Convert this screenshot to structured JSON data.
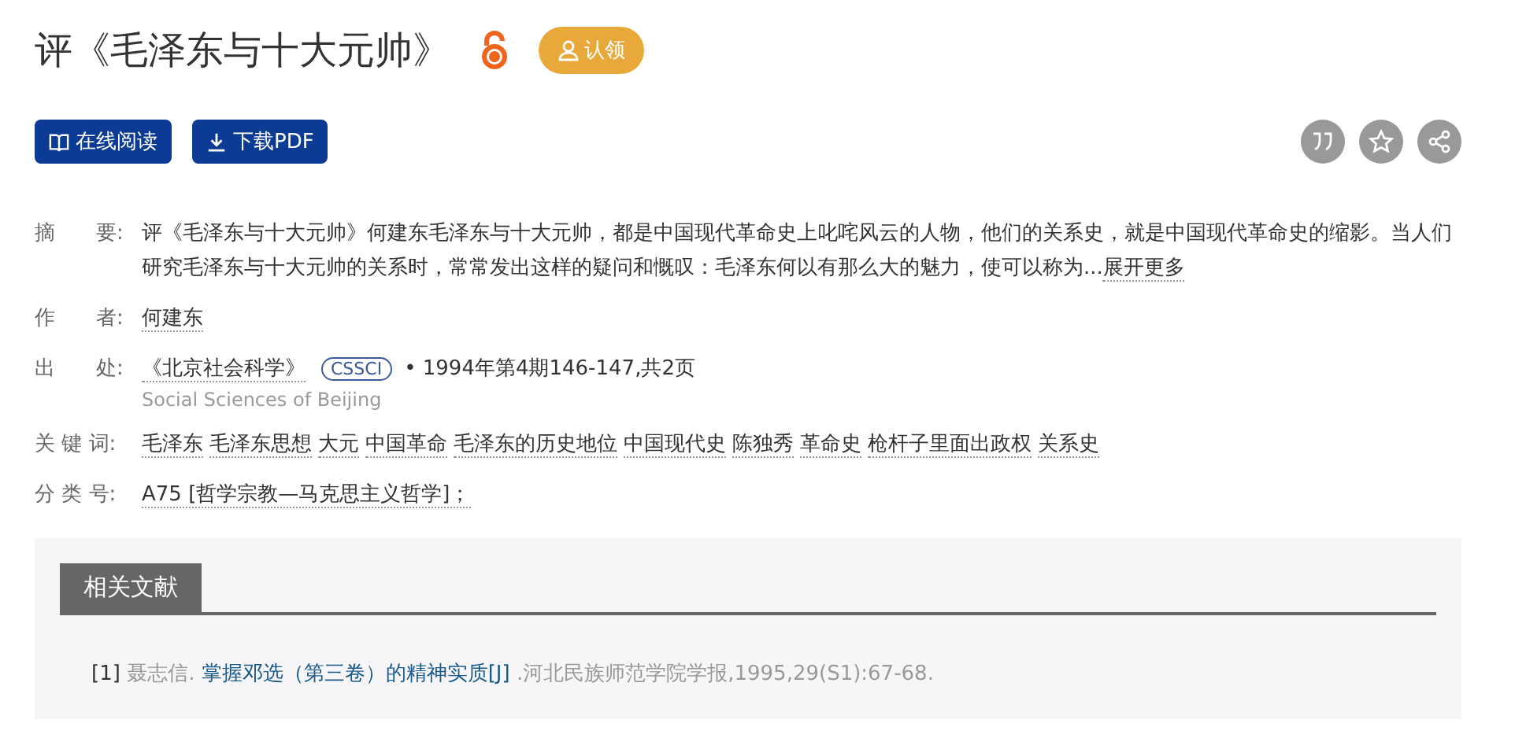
{
  "title": "评《毛泽东与十大元帅》",
  "open_access": true,
  "claim_button": "认领",
  "actions": [
    {
      "kind": "read",
      "label": "在线阅读"
    },
    {
      "kind": "download",
      "label": "下载PDF"
    }
  ],
  "tools": [
    {
      "kind": "cite"
    },
    {
      "kind": "favorite"
    },
    {
      "kind": "share"
    }
  ],
  "meta": [
    {
      "kind": "abstract",
      "label": "摘　　要:",
      "text": "评《毛泽东与十大元帅》何建东毛泽东与十大元帅，都是中国现代革命史上叱咤风云的人物，他们的关系史，就是中国现代革命史的缩影。当人们研究毛泽东与十大元帅的关系时，常常发出这样的疑问和慨叹：毛泽东何以有那么大的魅力，使可以称为...",
      "more": "展开更多"
    },
    {
      "kind": "links",
      "label": "作　　者:",
      "items": [
        "何建东"
      ]
    },
    {
      "kind": "source",
      "label": "出　　处:",
      "journal": "《北京社会科学》",
      "badge": "CSSCI",
      "separator": "•",
      "issue": "1994年第4期146-147,共2页",
      "subtitle": "Social Sciences of Beijing"
    },
    {
      "kind": "links",
      "label": "关 键 词:",
      "items": [
        "毛泽东",
        "毛泽东思想",
        "大元",
        "中国革命",
        "毛泽东的历史地位",
        "中国现代史",
        "陈独秀",
        "革命史",
        "枪杆子里面出政权",
        "关系史"
      ]
    },
    {
      "kind": "links",
      "label": "分 类 号:",
      "items": [
        "A75 [哲学宗教—马克思主义哲学]；"
      ]
    }
  ],
  "related": {
    "tab": "相关文献",
    "references": [
      {
        "index": "[1]",
        "author": "聂志信.",
        "title": "掌握邓选（第三卷）的精神实质[J]",
        "source": ".河北民族师范学院学报,1995,29(S1):67-68."
      }
    ]
  }
}
